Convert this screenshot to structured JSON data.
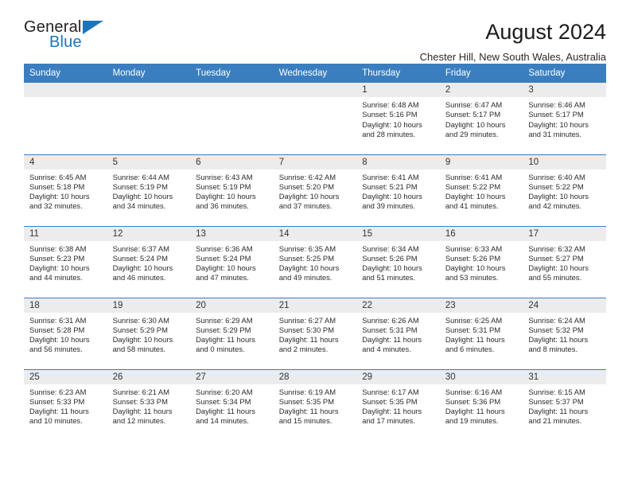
{
  "brand": {
    "name_part1": "General",
    "name_part2": "Blue",
    "triangle_icon": "triangle-icon",
    "accent_color": "#1b75bb"
  },
  "header": {
    "title": "August 2024",
    "location": "Chester Hill, New South Wales, Australia"
  },
  "theme": {
    "header_row_color": "#3a7ebf",
    "daynum_band_color": "#ececec",
    "text_color": "#2b2b2b"
  },
  "calendar": {
    "weekday_headers": [
      "Sunday",
      "Monday",
      "Tuesday",
      "Wednesday",
      "Thursday",
      "Friday",
      "Saturday"
    ],
    "labels": {
      "sunrise": "Sunrise:",
      "sunset": "Sunset:",
      "daylight": "Daylight:"
    },
    "weeks": [
      [
        {
          "day": "",
          "blank": true
        },
        {
          "day": "",
          "blank": true
        },
        {
          "day": "",
          "blank": true
        },
        {
          "day": "",
          "blank": true
        },
        {
          "day": "1",
          "sunrise": "Sunrise: 6:48 AM",
          "sunset": "Sunset: 5:16 PM",
          "daylight_l1": "Daylight: 10 hours",
          "daylight_l2": "and 28 minutes."
        },
        {
          "day": "2",
          "sunrise": "Sunrise: 6:47 AM",
          "sunset": "Sunset: 5:17 PM",
          "daylight_l1": "Daylight: 10 hours",
          "daylight_l2": "and 29 minutes."
        },
        {
          "day": "3",
          "sunrise": "Sunrise: 6:46 AM",
          "sunset": "Sunset: 5:17 PM",
          "daylight_l1": "Daylight: 10 hours",
          "daylight_l2": "and 31 minutes."
        }
      ],
      [
        {
          "day": "4",
          "sunrise": "Sunrise: 6:45 AM",
          "sunset": "Sunset: 5:18 PM",
          "daylight_l1": "Daylight: 10 hours",
          "daylight_l2": "and 32 minutes."
        },
        {
          "day": "5",
          "sunrise": "Sunrise: 6:44 AM",
          "sunset": "Sunset: 5:19 PM",
          "daylight_l1": "Daylight: 10 hours",
          "daylight_l2": "and 34 minutes."
        },
        {
          "day": "6",
          "sunrise": "Sunrise: 6:43 AM",
          "sunset": "Sunset: 5:19 PM",
          "daylight_l1": "Daylight: 10 hours",
          "daylight_l2": "and 36 minutes."
        },
        {
          "day": "7",
          "sunrise": "Sunrise: 6:42 AM",
          "sunset": "Sunset: 5:20 PM",
          "daylight_l1": "Daylight: 10 hours",
          "daylight_l2": "and 37 minutes."
        },
        {
          "day": "8",
          "sunrise": "Sunrise: 6:41 AM",
          "sunset": "Sunset: 5:21 PM",
          "daylight_l1": "Daylight: 10 hours",
          "daylight_l2": "and 39 minutes."
        },
        {
          "day": "9",
          "sunrise": "Sunrise: 6:41 AM",
          "sunset": "Sunset: 5:22 PM",
          "daylight_l1": "Daylight: 10 hours",
          "daylight_l2": "and 41 minutes."
        },
        {
          "day": "10",
          "sunrise": "Sunrise: 6:40 AM",
          "sunset": "Sunset: 5:22 PM",
          "daylight_l1": "Daylight: 10 hours",
          "daylight_l2": "and 42 minutes."
        }
      ],
      [
        {
          "day": "11",
          "sunrise": "Sunrise: 6:38 AM",
          "sunset": "Sunset: 5:23 PM",
          "daylight_l1": "Daylight: 10 hours",
          "daylight_l2": "and 44 minutes."
        },
        {
          "day": "12",
          "sunrise": "Sunrise: 6:37 AM",
          "sunset": "Sunset: 5:24 PM",
          "daylight_l1": "Daylight: 10 hours",
          "daylight_l2": "and 46 minutes."
        },
        {
          "day": "13",
          "sunrise": "Sunrise: 6:36 AM",
          "sunset": "Sunset: 5:24 PM",
          "daylight_l1": "Daylight: 10 hours",
          "daylight_l2": "and 47 minutes."
        },
        {
          "day": "14",
          "sunrise": "Sunrise: 6:35 AM",
          "sunset": "Sunset: 5:25 PM",
          "daylight_l1": "Daylight: 10 hours",
          "daylight_l2": "and 49 minutes."
        },
        {
          "day": "15",
          "sunrise": "Sunrise: 6:34 AM",
          "sunset": "Sunset: 5:26 PM",
          "daylight_l1": "Daylight: 10 hours",
          "daylight_l2": "and 51 minutes."
        },
        {
          "day": "16",
          "sunrise": "Sunrise: 6:33 AM",
          "sunset": "Sunset: 5:26 PM",
          "daylight_l1": "Daylight: 10 hours",
          "daylight_l2": "and 53 minutes."
        },
        {
          "day": "17",
          "sunrise": "Sunrise: 6:32 AM",
          "sunset": "Sunset: 5:27 PM",
          "daylight_l1": "Daylight: 10 hours",
          "daylight_l2": "and 55 minutes."
        }
      ],
      [
        {
          "day": "18",
          "sunrise": "Sunrise: 6:31 AM",
          "sunset": "Sunset: 5:28 PM",
          "daylight_l1": "Daylight: 10 hours",
          "daylight_l2": "and 56 minutes."
        },
        {
          "day": "19",
          "sunrise": "Sunrise: 6:30 AM",
          "sunset": "Sunset: 5:29 PM",
          "daylight_l1": "Daylight: 10 hours",
          "daylight_l2": "and 58 minutes."
        },
        {
          "day": "20",
          "sunrise": "Sunrise: 6:29 AM",
          "sunset": "Sunset: 5:29 PM",
          "daylight_l1": "Daylight: 11 hours",
          "daylight_l2": "and 0 minutes."
        },
        {
          "day": "21",
          "sunrise": "Sunrise: 6:27 AM",
          "sunset": "Sunset: 5:30 PM",
          "daylight_l1": "Daylight: 11 hours",
          "daylight_l2": "and 2 minutes."
        },
        {
          "day": "22",
          "sunrise": "Sunrise: 6:26 AM",
          "sunset": "Sunset: 5:31 PM",
          "daylight_l1": "Daylight: 11 hours",
          "daylight_l2": "and 4 minutes."
        },
        {
          "day": "23",
          "sunrise": "Sunrise: 6:25 AM",
          "sunset": "Sunset: 5:31 PM",
          "daylight_l1": "Daylight: 11 hours",
          "daylight_l2": "and 6 minutes."
        },
        {
          "day": "24",
          "sunrise": "Sunrise: 6:24 AM",
          "sunset": "Sunset: 5:32 PM",
          "daylight_l1": "Daylight: 11 hours",
          "daylight_l2": "and 8 minutes."
        }
      ],
      [
        {
          "day": "25",
          "sunrise": "Sunrise: 6:23 AM",
          "sunset": "Sunset: 5:33 PM",
          "daylight_l1": "Daylight: 11 hours",
          "daylight_l2": "and 10 minutes."
        },
        {
          "day": "26",
          "sunrise": "Sunrise: 6:21 AM",
          "sunset": "Sunset: 5:33 PM",
          "daylight_l1": "Daylight: 11 hours",
          "daylight_l2": "and 12 minutes."
        },
        {
          "day": "27",
          "sunrise": "Sunrise: 6:20 AM",
          "sunset": "Sunset: 5:34 PM",
          "daylight_l1": "Daylight: 11 hours",
          "daylight_l2": "and 14 minutes."
        },
        {
          "day": "28",
          "sunrise": "Sunrise: 6:19 AM",
          "sunset": "Sunset: 5:35 PM",
          "daylight_l1": "Daylight: 11 hours",
          "daylight_l2": "and 15 minutes."
        },
        {
          "day": "29",
          "sunrise": "Sunrise: 6:17 AM",
          "sunset": "Sunset: 5:35 PM",
          "daylight_l1": "Daylight: 11 hours",
          "daylight_l2": "and 17 minutes."
        },
        {
          "day": "30",
          "sunrise": "Sunrise: 6:16 AM",
          "sunset": "Sunset: 5:36 PM",
          "daylight_l1": "Daylight: 11 hours",
          "daylight_l2": "and 19 minutes."
        },
        {
          "day": "31",
          "sunrise": "Sunrise: 6:15 AM",
          "sunset": "Sunset: 5:37 PM",
          "daylight_l1": "Daylight: 11 hours",
          "daylight_l2": "and 21 minutes."
        }
      ]
    ]
  }
}
